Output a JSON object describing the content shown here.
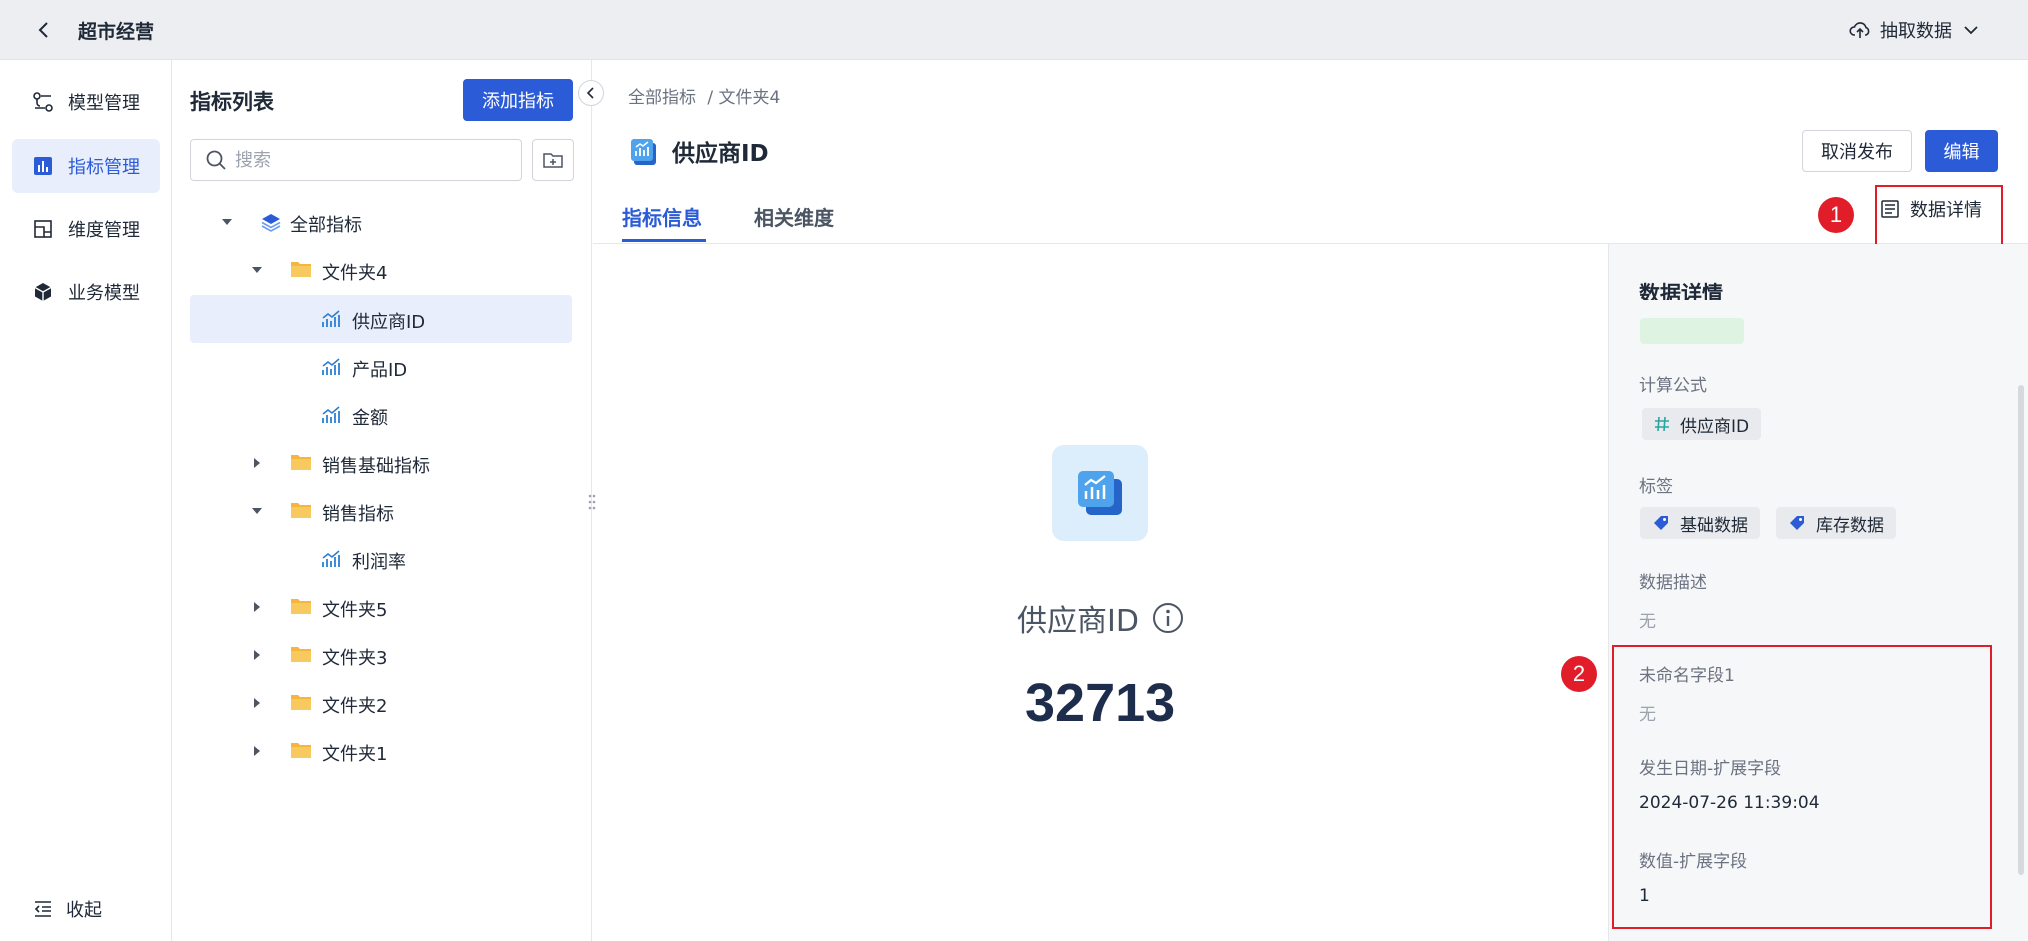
{
  "app": {
    "title": "超市经营",
    "extract_label": "抽取数据"
  },
  "nav": {
    "items": [
      {
        "label": "模型管理",
        "icon": "model-icon"
      },
      {
        "label": "指标管理",
        "icon": "metric-icon"
      },
      {
        "label": "维度管理",
        "icon": "dimension-icon"
      },
      {
        "label": "业务模型",
        "icon": "cube-icon"
      }
    ],
    "collapse_label": "收起"
  },
  "tree": {
    "title": "指标列表",
    "add_label": "添加指标",
    "search_placeholder": "搜索",
    "items": [
      {
        "label": "全部指标",
        "type": "root",
        "expanded": true
      },
      {
        "label": "文件夹4",
        "type": "folder",
        "expanded": true
      },
      {
        "label": "供应商ID",
        "type": "metric",
        "selected": true
      },
      {
        "label": "产品ID",
        "type": "metric"
      },
      {
        "label": "金额",
        "type": "metric"
      },
      {
        "label": "销售基础指标",
        "type": "folder",
        "expanded": false
      },
      {
        "label": "销售指标",
        "type": "folder",
        "expanded": true
      },
      {
        "label": "利润率",
        "type": "metric"
      },
      {
        "label": "文件夹5",
        "type": "folder",
        "expanded": false
      },
      {
        "label": "文件夹3",
        "type": "folder",
        "expanded": false
      },
      {
        "label": "文件夹2",
        "type": "folder",
        "expanded": false
      },
      {
        "label": "文件夹1",
        "type": "folder",
        "expanded": false
      }
    ]
  },
  "breadcrumb": [
    "全部指标",
    "/ 文件夹4"
  ],
  "metric": {
    "name": "供应商ID",
    "unpublish_label": "取消发布",
    "edit_label": "编辑",
    "value": "32713"
  },
  "tabs": [
    {
      "label": "指标信息",
      "active": true
    },
    {
      "label": "相关维度",
      "active": false
    }
  ],
  "detail_link": "数据详情",
  "annotations": [
    "1",
    "2"
  ],
  "details": {
    "title": "数据详情",
    "formula_label": "计算公式",
    "formula_value": "供应商ID",
    "tags_label": "标签",
    "tags": [
      "基础数据",
      "库存数据"
    ],
    "desc_label": "数据描述",
    "desc_value": "无",
    "field1_label": "未命名字段1",
    "field1_value": "无",
    "field2_label": "发生日期-扩展字段",
    "field2_value": "2024-07-26 11:39:04",
    "field3_label": "数值-扩展字段",
    "field3_value": "1"
  },
  "colors": {
    "primary": "#2b5bd6",
    "annotation": "#e11d2a",
    "folder": "#f5b640",
    "metric_icon": "#2b7fd6"
  }
}
